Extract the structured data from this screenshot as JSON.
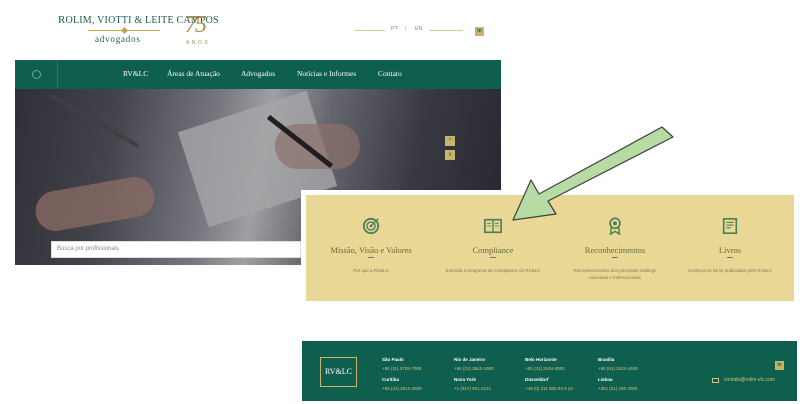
{
  "header": {
    "logo_prefix": "R",
    "logo_name": "OLIM, VIOTTI & LEITE CAMPOS",
    "logo_sub": "advogados",
    "logo_years": "75",
    "logo_anos": "ANOS",
    "lang_pt": "PT",
    "lang_sep": "/",
    "lang_en": "EN",
    "linkedin_label": "in"
  },
  "nav": {
    "items": [
      "RV&LC",
      "Áreas de Atuação",
      "Advogados",
      "Notícias e Informes",
      "Contato"
    ]
  },
  "hero": {
    "arrow_up": "^",
    "arrow_down": "v",
    "search_placeholder": "Busca por profissionais"
  },
  "features": [
    {
      "title": "Missão, Visão e Valores",
      "dash": "–",
      "desc": "Por que a RV&LC",
      "icon": "target-icon"
    },
    {
      "title": "Compliance",
      "dash": "–",
      "desc": "Entenda o programa de Compliance do RV&LC",
      "icon": "book-icon"
    },
    {
      "title": "Reconhecimentos",
      "dash": "–",
      "desc": "Reconhecimentos dos principais rankings nacionais e internacionais",
      "icon": "award-icon"
    },
    {
      "title": "Livros",
      "dash": "–",
      "desc": "Conheça os livros publicados pelo RV&LC",
      "icon": "books-icon"
    }
  ],
  "footer": {
    "logo": "RV&LC",
    "offices": [
      {
        "city": "São Paulo",
        "phone": "+55 (11) 3759-7000"
      },
      {
        "city": "Rio de Janeiro",
        "phone": "+55 (21) 3543-1600"
      },
      {
        "city": "Belo Horizonte",
        "phone": "+55 (31) 2104-3000"
      },
      {
        "city": "Brasília",
        "phone": "+55 (61) 3424-4400"
      },
      {
        "city": "Curitiba",
        "phone": "+55 (41) 3012-2600"
      },
      {
        "city": "Nova York",
        "phone": "+1 (917) 601-2141"
      },
      {
        "city": "Düsseldorf",
        "phone": "+49 (0) 211 868 93 9 24"
      },
      {
        "city": "Lisboa",
        "phone": "+351 (21) 150 0060"
      }
    ],
    "linkedin_label": "in",
    "email": "contato@rolim-vlc.com"
  },
  "colors": {
    "brand_green": "#0f5f4e",
    "gold": "#c7b46a",
    "panel_bg": "#e9d795",
    "arrow_green": "#b6dca4"
  }
}
